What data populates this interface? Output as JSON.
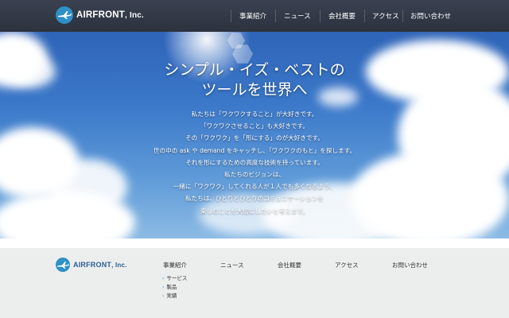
{
  "header": {
    "logo_text": "AIRFRONT",
    "logo_suffix": ", Inc.",
    "nav": [
      "事業紹介",
      "ニュース",
      "会社概要",
      "アクセス",
      "お問い合わせ"
    ]
  },
  "hero": {
    "title_lines": [
      "シンプル・イズ・ベストの",
      "ツールを世界へ"
    ],
    "body_lines": [
      "私たちは「ワクワクすること」が大好きです。",
      "「ワクワクさせること」も大好きです。",
      "その「ワクワク」を「形にする」のが大好きです。",
      "世の中の ask や demand をキャッチし、「ワクワクのもと」を探します。",
      "それを形にするための高度な技術を持っています。",
      "私たちのビジョンは、",
      "一緒に「ワクワク」してくれる人が１人でも多くなるよう、",
      "私たちは、ひとりとひとりのコミュニケーションを",
      "楽しむことを大切にしたいと考えます。"
    ]
  },
  "footer": {
    "logo_text": "AIRFRONT",
    "logo_suffix": ", Inc.",
    "nav": [
      "事業紹介",
      "ニュース",
      "会社概要",
      "アクセス",
      "お問い合わせ"
    ],
    "sub_items": [
      "サービス",
      "製品",
      "実績"
    ]
  },
  "colors": {
    "header_bg": "#2f3541",
    "logo_blue": "#2f8fc7",
    "footer_bg": "#eceeee",
    "sky": "#3b78c9"
  },
  "icons": {
    "logo": "airplane-circle-icon",
    "footer_bullet": "chevron-right-icon"
  }
}
